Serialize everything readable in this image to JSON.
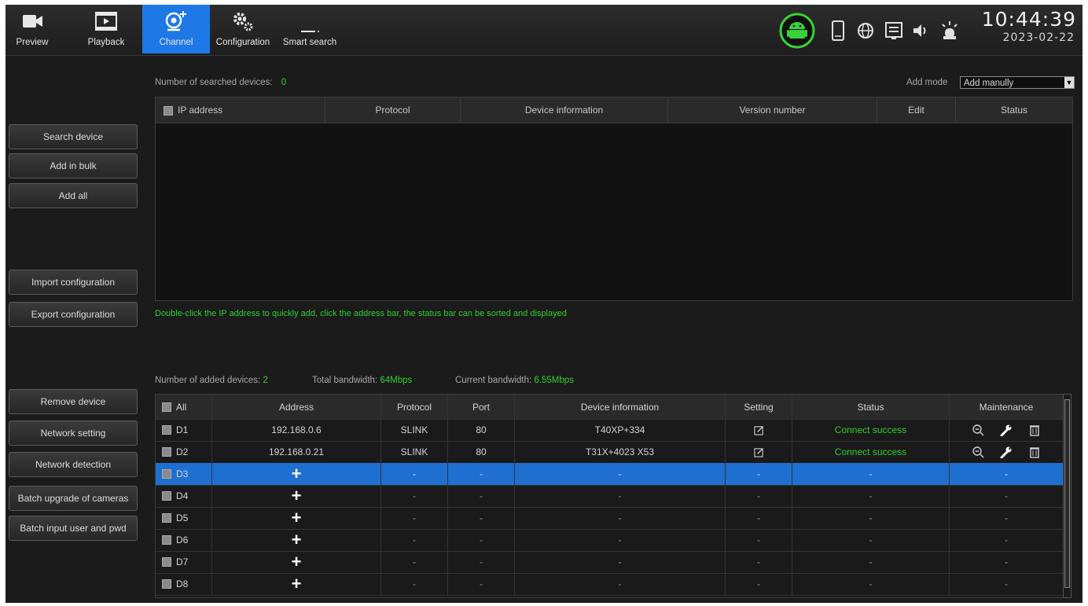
{
  "nav": [
    {
      "id": "preview",
      "label": "Preview",
      "icon": "video-camera-icon",
      "active": false
    },
    {
      "id": "playback",
      "label": "Playback",
      "icon": "film-playback-icon",
      "active": false
    },
    {
      "id": "channel",
      "label": "Channel",
      "icon": "channel-camera-add-icon",
      "active": true
    },
    {
      "id": "configuration",
      "label": "Configuration",
      "icon": "gears-icon",
      "active": false
    },
    {
      "id": "smart_search",
      "label": "Smart search",
      "icon": "smart-search-icon",
      "active": false
    }
  ],
  "clock": {
    "time": "10:44:39",
    "date": "2023-02-22"
  },
  "status_icons": [
    "android-icon",
    "phone-icon",
    "globe-icon",
    "network-panel-icon",
    "speaker-icon",
    "alarm-icon"
  ],
  "sidebar": {
    "search_device": "Search device",
    "add_in_bulk": "Add in bulk",
    "add_all": "Add all",
    "import_configuration": "Import configuration",
    "export_configuration": "Export configuration",
    "remove_device": "Remove device",
    "network_setting": "Network setting",
    "network_detection": "Network detection",
    "batch_upgrade": "Batch upgrade of cameras",
    "batch_input": "Batch input user and pwd"
  },
  "search": {
    "count_label": "Number of searched devices:",
    "count_value": "0",
    "add_mode_label": "Add mode",
    "add_mode_value": "Add manully",
    "columns": [
      "IP address",
      "Protocol",
      "Device information",
      "Version number",
      "Edit",
      "Status"
    ],
    "hint": "Double-click the IP address to quickly add, click the address bar, the status bar can be sorted and displayed"
  },
  "added": {
    "count_label": "Number of added devices:",
    "count_value": "2",
    "total_bw_label": "Total bandwidth:",
    "total_bw_value": "64Mbps",
    "current_bw_label": "Current bandwidth:",
    "current_bw_value": "6.55Mbps",
    "columns": [
      "All",
      "Address",
      "Protocol",
      "Port",
      "Device information",
      "Setting",
      "Status",
      "Maintenance"
    ],
    "rows": [
      {
        "ch": "D1",
        "address": "192.168.0.6",
        "protocol": "SLINK",
        "port": "80",
        "info": "T40XP+334",
        "setting": "edit",
        "status": "Connect success",
        "maintenance": "-",
        "added": true,
        "selected": false
      },
      {
        "ch": "D2",
        "address": "192.168.0.21",
        "protocol": "SLINK",
        "port": "80",
        "info": "T31X+4023 X53",
        "setting": "edit",
        "status": "Connect success",
        "maintenance": "-",
        "added": true,
        "selected": false
      },
      {
        "ch": "D3",
        "address": "+",
        "protocol": "-",
        "port": "-",
        "info": "-",
        "setting": "-",
        "status": "-",
        "maintenance": "-",
        "added": false,
        "selected": true
      },
      {
        "ch": "D4",
        "address": "+",
        "protocol": "-",
        "port": "-",
        "info": "-",
        "setting": "-",
        "status": "-",
        "maintenance": "-",
        "added": false,
        "selected": false
      },
      {
        "ch": "D5",
        "address": "+",
        "protocol": "-",
        "port": "-",
        "info": "-",
        "setting": "-",
        "status": "-",
        "maintenance": "-",
        "added": false,
        "selected": false
      },
      {
        "ch": "D6",
        "address": "+",
        "protocol": "-",
        "port": "-",
        "info": "-",
        "setting": "-",
        "status": "-",
        "maintenance": "-",
        "added": false,
        "selected": false
      },
      {
        "ch": "D7",
        "address": "+",
        "protocol": "-",
        "port": "-",
        "info": "-",
        "setting": "-",
        "status": "-",
        "maintenance": "-",
        "added": false,
        "selected": false
      },
      {
        "ch": "D8",
        "address": "+",
        "protocol": "-",
        "port": "-",
        "info": "-",
        "setting": "-",
        "status": "-",
        "maintenance": "-",
        "added": false,
        "selected": false
      }
    ]
  },
  "colors": {
    "accent": "#1e78e6",
    "selected_row": "#1f6fd1",
    "success": "#2fd12f",
    "android": "#3ad13a"
  }
}
